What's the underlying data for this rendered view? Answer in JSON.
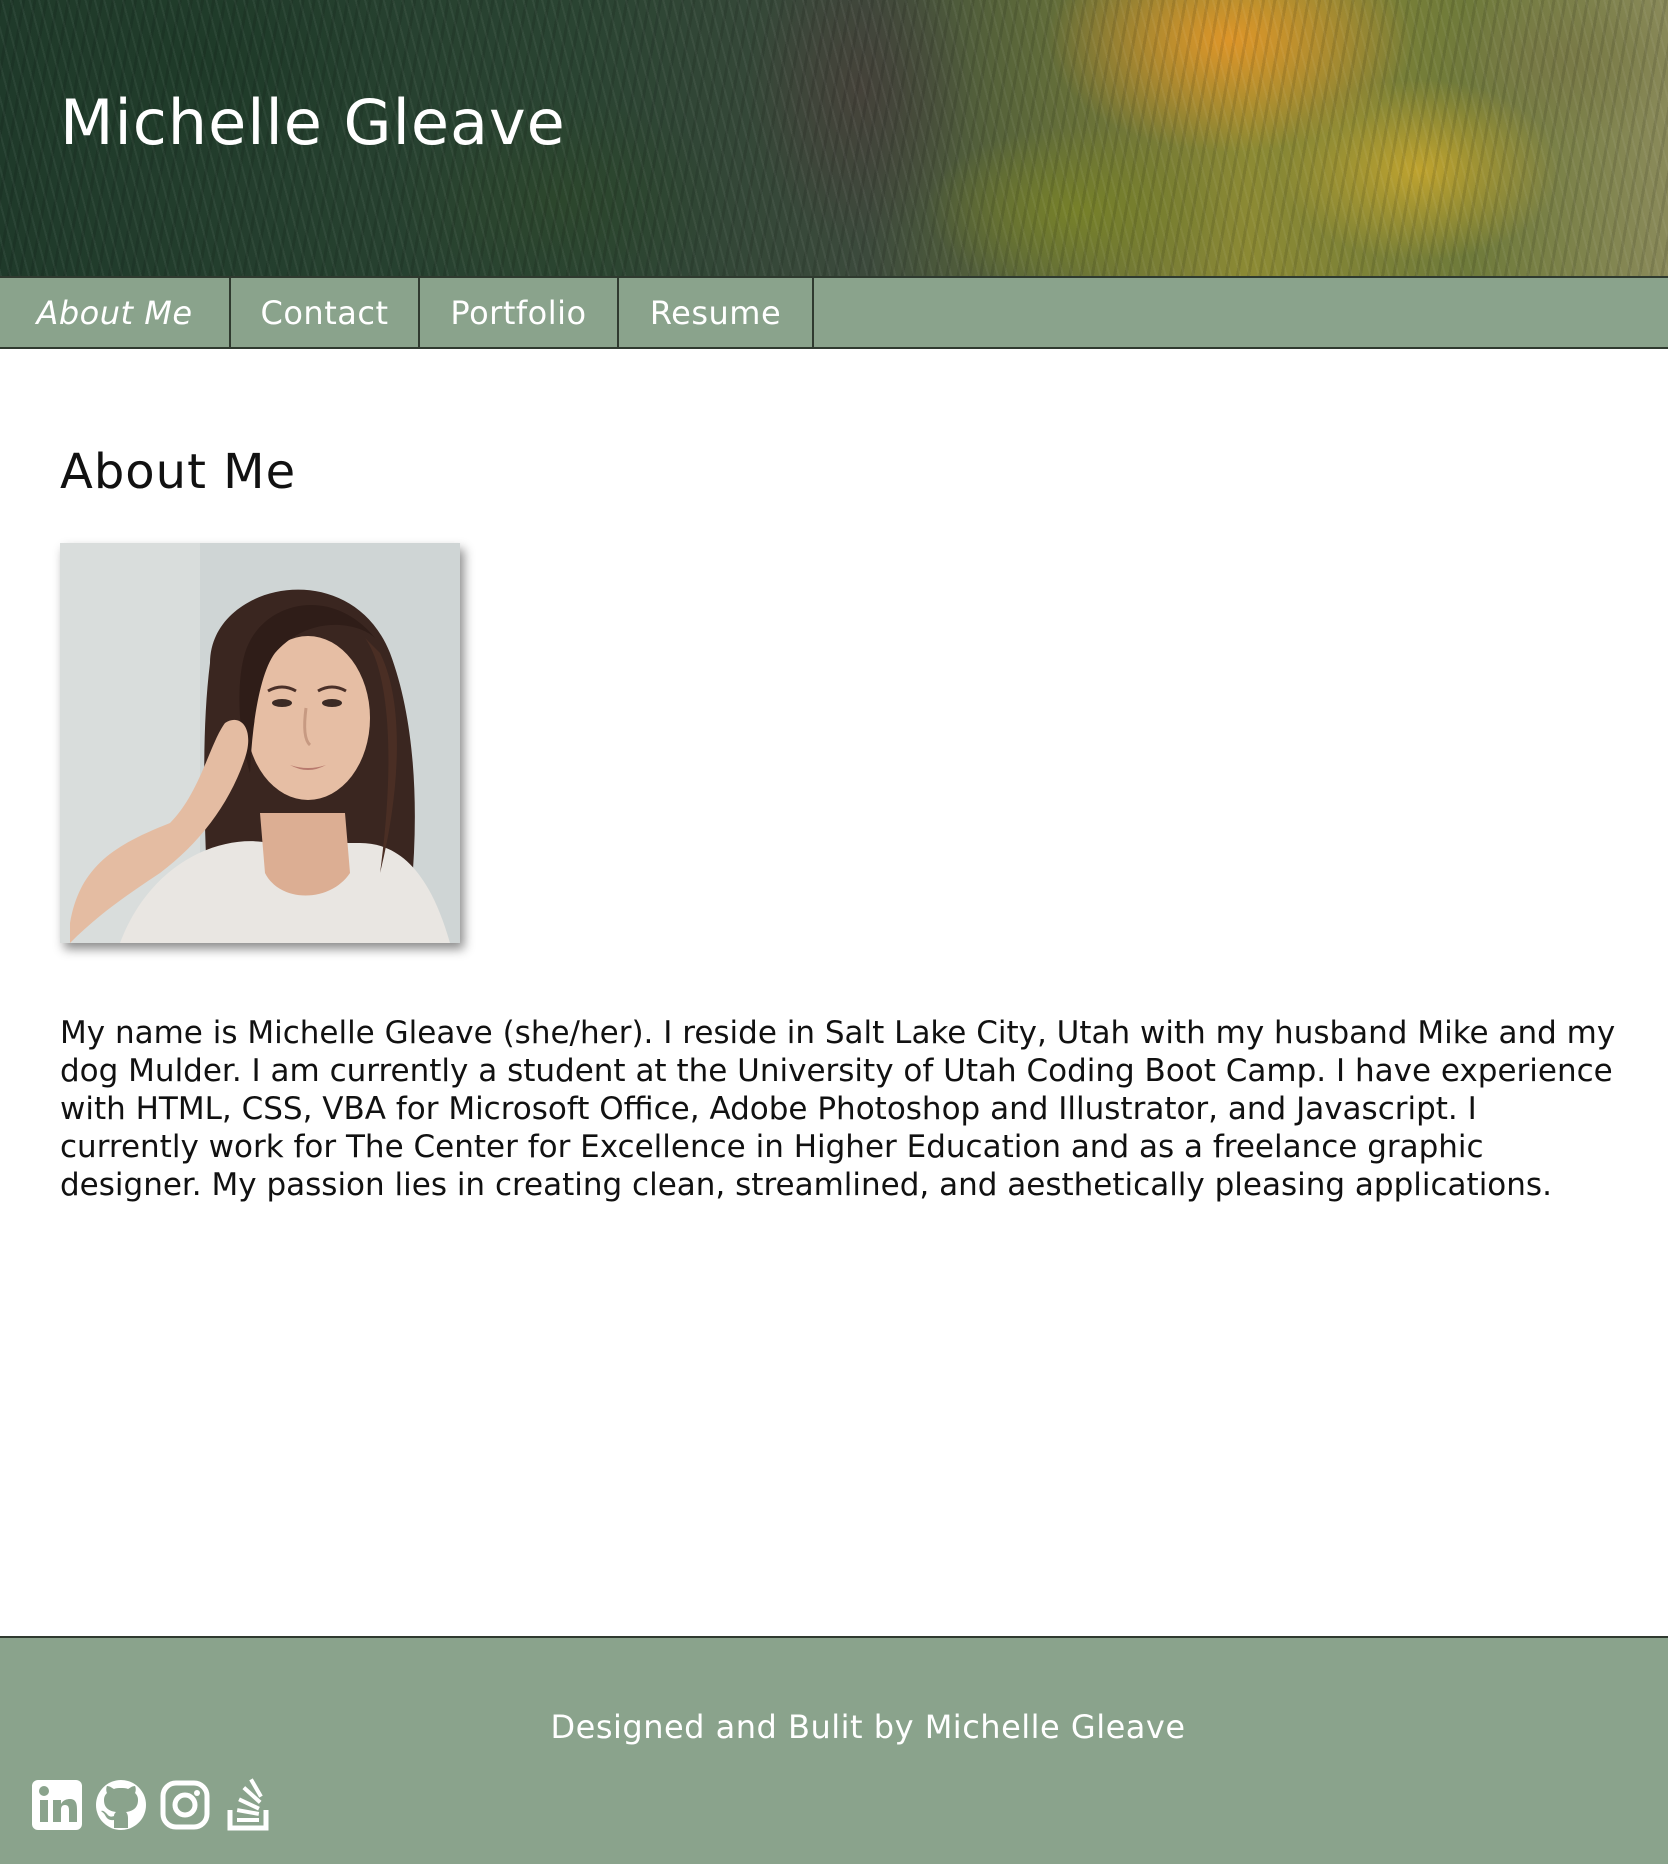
{
  "header": {
    "site_title": "Michelle Gleave"
  },
  "nav": {
    "items": [
      {
        "label": "About Me",
        "active": true
      },
      {
        "label": "Contact",
        "active": false
      },
      {
        "label": "Portfolio",
        "active": false
      },
      {
        "label": "Resume",
        "active": false
      }
    ]
  },
  "main": {
    "section_title": "About Me",
    "bio": "My name is Michelle Gleave (she/her). I reside in Salt Lake City, Utah with my husband Mike and my dog Mulder. I am currently a student at the University of Utah Coding Boot Camp. I have experience with HTML, CSS, VBA for Microsoft Office, Adobe Photoshop and Illustrator, and Javascript. I currently work for The Center for Excellence in Higher Education and as a freelance graphic designer. My passion lies in creating clean, streamlined, and aesthetically pleasing applications."
  },
  "footer": {
    "credit": "Designed and Bulit by Michelle Gleave",
    "social_icons": [
      "linkedin-icon",
      "github-icon",
      "instagram-icon",
      "stackoverflow-icon"
    ]
  },
  "colors": {
    "nav_bg": "#8aa38c",
    "footer_bg": "#8aa38c",
    "border": "#2f3a2f",
    "text": "#111111",
    "nav_text": "#ffffff"
  }
}
